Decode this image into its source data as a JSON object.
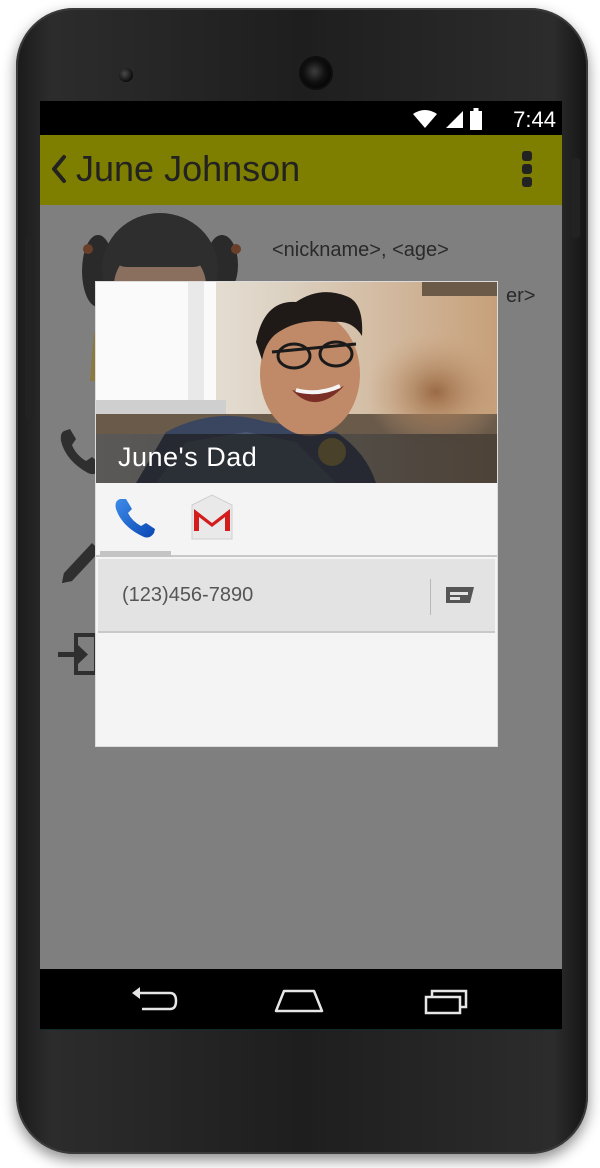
{
  "status_bar": {
    "time": "7:44",
    "icons": [
      "wifi-icon",
      "signal-icon",
      "battery-icon"
    ]
  },
  "app_bar": {
    "title": "June Johnson",
    "color": "#7e7e00",
    "back_icon": "chevron-left-icon",
    "menu_icon": "overflow-menu-icon"
  },
  "profile": {
    "nickname_age": "<nickname>, <age>",
    "partial_text": "er>"
  },
  "background_actions": [
    "phone-icon",
    "pencil-icon",
    "sign-in-icon"
  ],
  "dialog": {
    "contact_name": "June's Dad",
    "tabs": [
      {
        "name": "phone",
        "icon": "phone-icon",
        "selected": true
      },
      {
        "name": "email",
        "icon": "gmail-icon",
        "selected": false
      }
    ],
    "phone_number": "(123)456-7890",
    "message_icon": "message-icon"
  },
  "nav_bar": [
    "back-icon",
    "home-icon",
    "recents-icon"
  ]
}
